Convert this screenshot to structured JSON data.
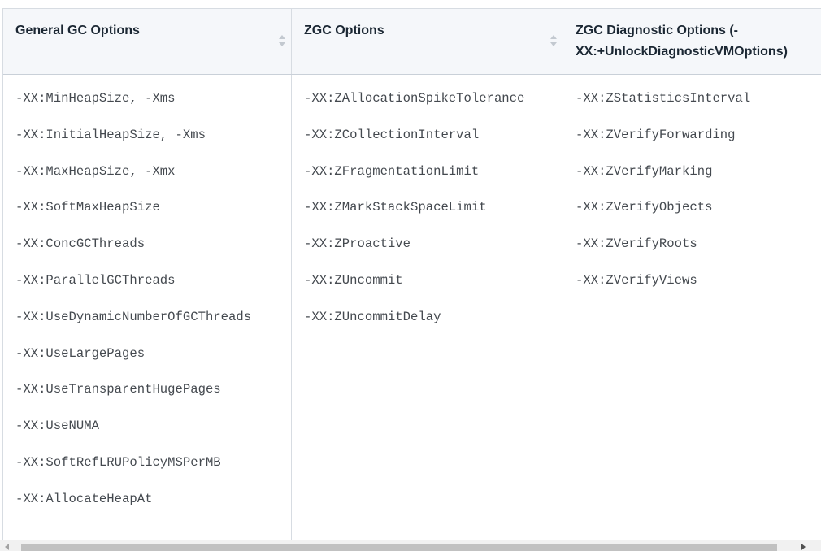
{
  "table": {
    "columns": [
      {
        "header": "General GC Options",
        "items": [
          "-XX:MinHeapSize, -Xms",
          "-XX:InitialHeapSize, -Xms",
          "-XX:MaxHeapSize, -Xmx",
          "-XX:SoftMaxHeapSize",
          "-XX:ConcGCThreads",
          "-XX:ParallelGCThreads",
          "-XX:UseDynamicNumberOfGCThreads",
          "-XX:UseLargePages",
          "-XX:UseTransparentHugePages",
          "-XX:UseNUMA",
          "-XX:SoftRefLRUPolicyMSPerMB",
          "-XX:AllocateHeapAt"
        ]
      },
      {
        "header": "ZGC Options",
        "items": [
          "-XX:ZAllocationSpikeTolerance",
          "-XX:ZCollectionInterval",
          "-XX:ZFragmentationLimit",
          "-XX:ZMarkStackSpaceLimit",
          "-XX:ZProactive",
          "-XX:ZUncommit",
          "-XX:ZUncommitDelay"
        ]
      },
      {
        "header": "ZGC Diagnostic Options (-XX:+UnlockDiagnosticVMOptions)",
        "items": [
          "-XX:ZStatisticsInterval",
          "-XX:ZVerifyForwarding",
          "-XX:ZVerifyMarking",
          "-XX:ZVerifyObjects",
          "-XX:ZVerifyRoots",
          "-XX:ZVerifyViews"
        ]
      }
    ]
  },
  "icons": {
    "sort": "sort-arrows-icon",
    "scroll_left": "scroll-left-arrow-icon",
    "scroll_right": "scroll-right-arrow-icon"
  }
}
